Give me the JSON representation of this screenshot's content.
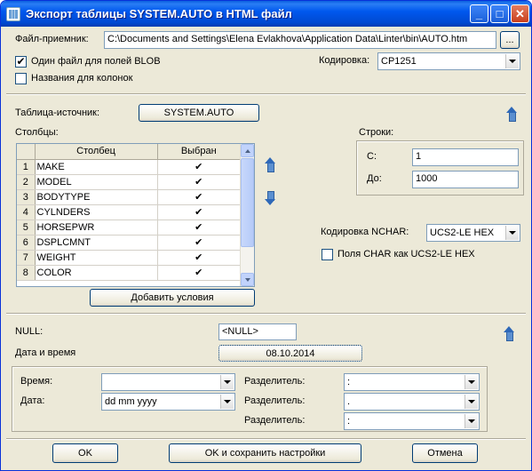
{
  "window": {
    "title": "Экспорт таблицы SYSTEM.AUTO в HTML файл",
    "minimize_glyph": "_",
    "maximize_glyph": "□",
    "close_glyph": "✕"
  },
  "file": {
    "label": "Файл-приемник:",
    "path": "C:\\Documents and Settings\\Elena Evlakhova\\Application Data\\Linter\\bin\\AUTO.htm",
    "browse_label": "..."
  },
  "options": {
    "one_file_blob_label": "Один файл для полей BLOB",
    "one_file_blob_checked": true,
    "column_names_label": "Названия для колонок",
    "column_names_checked": false
  },
  "encoding": {
    "label": "Кодировка:",
    "value": "CP1251"
  },
  "source": {
    "label": "Таблица-источник:",
    "table_button": "SYSTEM.AUTO"
  },
  "columns": {
    "label": "Столбцы:",
    "headers": [
      "",
      "Столбец",
      "Выбран"
    ],
    "rows": [
      {
        "num": "1",
        "name": "MAKE",
        "selected": "✔"
      },
      {
        "num": "2",
        "name": "MODEL",
        "selected": "✔"
      },
      {
        "num": "3",
        "name": "BODYTYPE",
        "selected": "✔"
      },
      {
        "num": "4",
        "name": "CYLNDERS",
        "selected": "✔"
      },
      {
        "num": "5",
        "name": "HORSEPWR",
        "selected": "✔"
      },
      {
        "num": "6",
        "name": "DSPLCMNT",
        "selected": "✔"
      },
      {
        "num": "7",
        "name": "WEIGHT",
        "selected": "✔"
      },
      {
        "num": "8",
        "name": "COLOR",
        "selected": "✔"
      }
    ],
    "add_conditions_label": "Добавить условия"
  },
  "rows_range": {
    "label": "Строки:",
    "from_label": "С:",
    "from_value": "1",
    "to_label": "До:",
    "to_value": "1000"
  },
  "nchar": {
    "label": "Кодировка NCHAR:",
    "value": "UCS2-LE HEX",
    "char_as_ucs2_label": "Поля CHAR как UCS2-LE HEX",
    "char_as_ucs2_checked": false
  },
  "null_value": {
    "label": "NULL:",
    "value": "<NULL>"
  },
  "datetime": {
    "label": "Дата и время",
    "button_value": "08.10.2014",
    "time_label": "Время:",
    "time_value": "",
    "date_label": "Дата:",
    "date_value": "dd mm yyyy",
    "separator_label_1": "Разделитель:",
    "separator_value_1": ":",
    "separator_label_2": "Разделитель:",
    "separator_value_2": ".",
    "separator_label_3": "Разделитель:",
    "separator_value_3": ":"
  },
  "footer": {
    "ok_label": "OK",
    "ok_save_label": "OK и сохранить настройки",
    "cancel_label": "Отмена"
  }
}
